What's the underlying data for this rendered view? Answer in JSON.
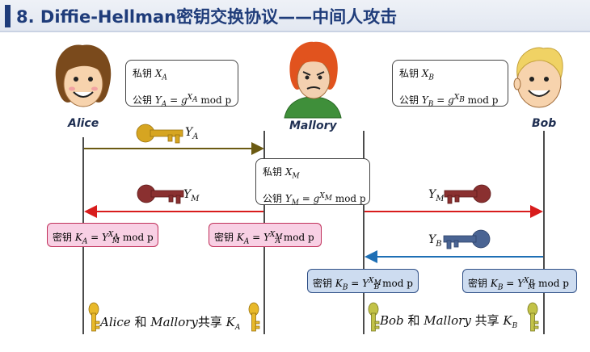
{
  "title": "8. Diffie-Hellman密钥交换协议——中间人攻击",
  "parties": {
    "alice": "Alice",
    "mallory": "Mallory",
    "bob": "Bob"
  },
  "labels": {
    "private_key": "私钥",
    "public_key": "公钥",
    "secret_key": "密钥",
    "mod_p": "mod p",
    "and": "和",
    "shared": "共享"
  },
  "messages": {
    "ya": "Y_A",
    "ym": "Y_M",
    "yb": "Y_B"
  },
  "colors": {
    "title": "#1f3c7a",
    "arrow_alice": "#6b5a12",
    "arrow_red": "#d81c1c",
    "arrow_blue": "#1e6fb5",
    "key_gold": "#d6a521",
    "key_red": "#8a3030",
    "key_blue": "#4a6493",
    "pink_box": "#f8d0e4",
    "blue_box": "#cddcf0"
  }
}
